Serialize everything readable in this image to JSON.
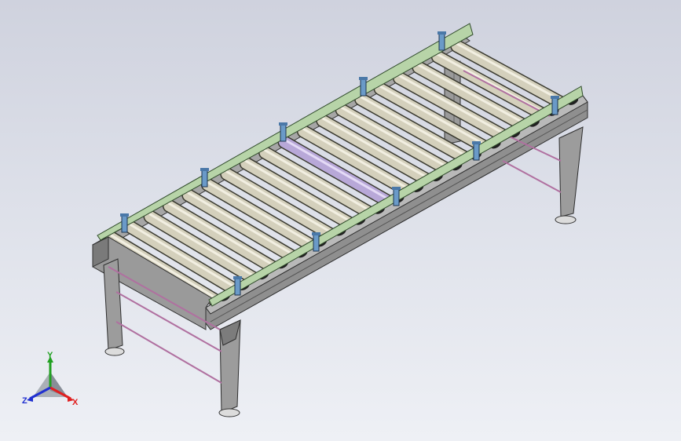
{
  "viewport": {
    "background_top": "#cfd2de",
    "background_bottom": "#eef0f5"
  },
  "model": {
    "roller_count": 19,
    "highlighted_roller_index": 9,
    "colors": {
      "frame": "#8f8f8f",
      "frame_dark": "#5a5a5a",
      "roller": "#d4d0bc",
      "roller_highlight": "#b8a8d8",
      "guide_rail": "#b7d4a8",
      "bracket": "#6a9ac8",
      "brace": "#b070a0",
      "chain": "#202020"
    }
  },
  "triad": {
    "x_label": "X",
    "y_label": "Y",
    "z_label": "Z",
    "x_color": "#e02020",
    "y_color": "#20a020",
    "z_color": "#2030d0"
  }
}
